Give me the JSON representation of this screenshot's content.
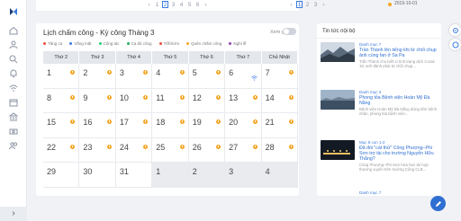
{
  "pager_left": [
    "1",
    "2",
    "3",
    "4",
    "5",
    "6"
  ],
  "pager_left_prev": "‹",
  "pager_left_next": "›",
  "pager_right": [
    "1",
    "2",
    "3"
  ],
  "pager_right_prev": "‹",
  "pager_right_next": "›",
  "top_date": "2019-10-01",
  "calendar": {
    "title": "Lịch chấm công - Kỳ công Tháng 3",
    "toggle_label": "Xem giờ",
    "legend": [
      {
        "label": "Tăng ca",
        "color": "#e74c3c"
      },
      {
        "label": "Vắng mặt",
        "color": "#3a7be0"
      },
      {
        "label": "Công tác",
        "color": "#2ecc71"
      },
      {
        "label": "Ca đủ công",
        "color": "#27ae60"
      },
      {
        "label": "Trễ/Sớm",
        "color": "#e74c3c"
      },
      {
        "label": "Quên chấm công",
        "color": "#f5a623"
      },
      {
        "label": "Nghỉ lễ",
        "color": "#8e44ad"
      }
    ],
    "weekdays": [
      "Thứ 2",
      "Thứ 3",
      "Thứ 4",
      "Thứ 5",
      "Thứ 6",
      "Thứ 7",
      "Chủ Nhật"
    ],
    "days": [
      {
        "n": "1",
        "m": "dot"
      },
      {
        "n": "2",
        "m": "dot"
      },
      {
        "n": "3",
        "m": "dot"
      },
      {
        "n": "4",
        "m": "dot"
      },
      {
        "n": "5",
        "m": "dot"
      },
      {
        "n": "6",
        "m": "wifi"
      },
      {
        "n": "7",
        "m": "dot"
      },
      {
        "n": "8",
        "m": "dot"
      },
      {
        "n": "9",
        "m": "dot"
      },
      {
        "n": "10",
        "m": "dot"
      },
      {
        "n": "11",
        "m": "dot"
      },
      {
        "n": "12",
        "m": "dot"
      },
      {
        "n": "13",
        "m": "dot"
      },
      {
        "n": "14",
        "m": "dot"
      },
      {
        "n": "15",
        "m": "dot"
      },
      {
        "n": "16",
        "m": "dot"
      },
      {
        "n": "17",
        "m": "dot"
      },
      {
        "n": "18",
        "m": "dot"
      },
      {
        "n": "19",
        "m": "dot"
      },
      {
        "n": "20",
        "m": "dot"
      },
      {
        "n": "21",
        "m": "dot"
      },
      {
        "n": "22",
        "m": "dot"
      },
      {
        "n": "23",
        "m": "dot"
      },
      {
        "n": "24",
        "m": "dot"
      },
      {
        "n": "25",
        "m": "dot"
      },
      {
        "n": "26",
        "m": "dot"
      },
      {
        "n": "27",
        "m": "dot"
      },
      {
        "n": "28",
        "m": "dot"
      },
      {
        "n": "29",
        "m": ""
      },
      {
        "n": "30",
        "m": ""
      },
      {
        "n": "31",
        "m": ""
      },
      {
        "n": "1",
        "m": "",
        "o": true
      },
      {
        "n": "2",
        "m": "",
        "o": true
      },
      {
        "n": "3",
        "m": "",
        "o": true
      },
      {
        "n": "4",
        "m": "",
        "o": true
      }
    ]
  },
  "news": {
    "title": "Tin tức nội bộ",
    "items": [
      {
        "cat": "Danh mục 7",
        "head": "Trần Thành lên tiếng khi từ chối chụp ảnh cùng fan ở Sa Pa",
        "ex": "Trấn Thành cho biết vì tình trạng dịch Covid-19, anh đành phải từ chối chụp..."
      },
      {
        "cat": "Danh mục 3",
        "head": "Phong tỏa Bệnh viện Hoàn Mỹ Đà Nẵng",
        "ex": "Bệnh viện Hoàn Mỹ Đà Nẵng dừng đón bệnh nhân, phong tỏa bệnh viện..."
      },
      {
        "cat": "Mục 8 con 1-2",
        "head": "Đã đòi \"cát thử\" Công Phượng–Phi Sơn trợ tài cho trường Nguyễn Hữu Thắng?",
        "ex": "Công Phượng–Phi Sơn hứa hẹn tài hợp thương xuyên trên trường Công CLB..."
      },
      {
        "cat": "Danh mục 7",
        "head": "",
        "ex": ""
      }
    ]
  },
  "icons": [
    "logo-icon",
    "home-icon",
    "user-icon",
    "search-icon",
    "bell-icon",
    "wifi-icon",
    "calendar-icon",
    "bank-icon",
    "money-icon",
    "users-icon",
    "chevron-right-icon",
    "settings-icon",
    "help-icon",
    "edit-icon"
  ],
  "colors": {
    "accent": "#2f6fd1",
    "warning": "#f5a623"
  }
}
